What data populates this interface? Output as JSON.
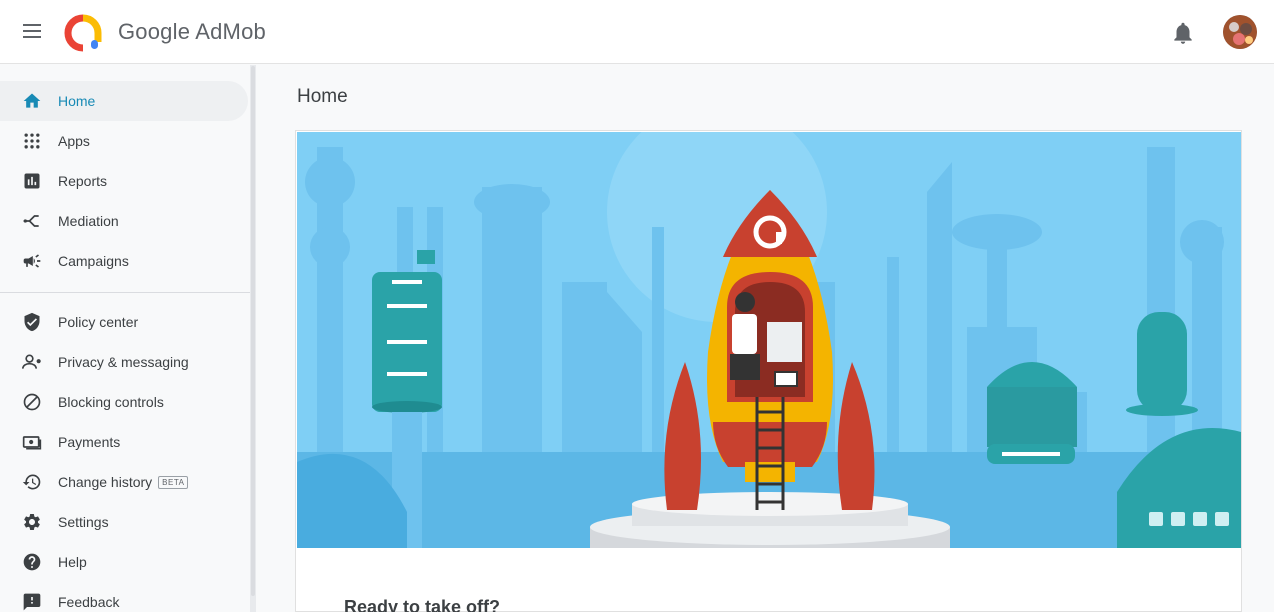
{
  "app": {
    "brand": "Google AdMob"
  },
  "header": {
    "menu_icon": "menu-icon",
    "logo_icon": "admob-logo-icon",
    "notifications_icon": "bell-icon",
    "avatar_icon": "user-avatar"
  },
  "sidebar": {
    "items": [
      {
        "label": "Home",
        "icon": "home-icon",
        "active": true
      },
      {
        "label": "Apps",
        "icon": "apps-grid-icon"
      },
      {
        "label": "Reports",
        "icon": "reports-icon"
      },
      {
        "label": "Mediation",
        "icon": "mediation-icon"
      },
      {
        "label": "Campaigns",
        "icon": "megaphone-icon"
      },
      {
        "label": "Policy center",
        "icon": "shield-icon"
      },
      {
        "label": "Privacy & messaging",
        "icon": "privacy-icon"
      },
      {
        "label": "Blocking controls",
        "icon": "block-icon"
      },
      {
        "label": "Payments",
        "icon": "payments-icon"
      },
      {
        "label": "Change history",
        "icon": "history-icon",
        "badge": "BETA"
      },
      {
        "label": "Settings",
        "icon": "gear-icon"
      },
      {
        "label": "Help",
        "icon": "help-icon"
      },
      {
        "label": "Feedback",
        "icon": "feedback-icon"
      }
    ]
  },
  "main": {
    "title": "Home",
    "card": {
      "heading": "Ready to take off?"
    }
  },
  "colors": {
    "accent": "#188ab5",
    "sky": "#7fcff5",
    "rocket_red": "#c8412f",
    "rocket_yellow": "#f4b400"
  }
}
